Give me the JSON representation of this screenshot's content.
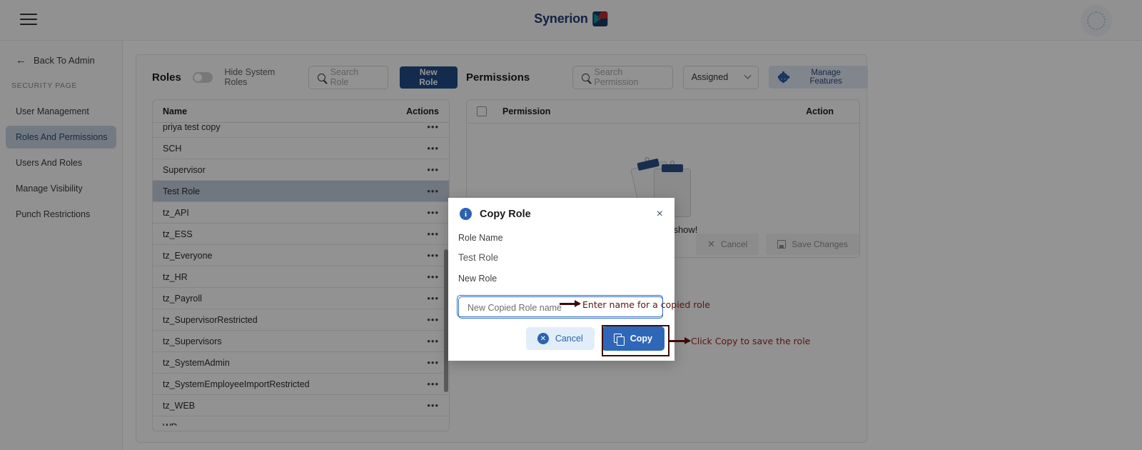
{
  "header": {
    "brand_name": "Synerion",
    "menu_icon": "hamburger-icon",
    "avatar_icon": "user-avatar"
  },
  "sidebar": {
    "back_label": "Back To Admin",
    "section_label": "SECURITY PAGE",
    "items": [
      {
        "label": "User Management",
        "active": false
      },
      {
        "label": "Roles And Permissions",
        "active": true
      },
      {
        "label": "Users And Roles",
        "active": false
      },
      {
        "label": "Manage Visibility",
        "active": false
      },
      {
        "label": "Punch Restrictions",
        "active": false
      }
    ]
  },
  "roles_panel": {
    "title": "Roles",
    "toggle_label": "Hide System Roles",
    "toggle_on": false,
    "search_placeholder": "Search Role",
    "new_role_label": "New Role",
    "columns": [
      "Name",
      "Actions"
    ],
    "action_glyph": "•••",
    "rows": [
      {
        "name": "priya test copy",
        "selected": false
      },
      {
        "name": "SCH",
        "selected": false
      },
      {
        "name": "Supervisor",
        "selected": false
      },
      {
        "name": "Test Role",
        "selected": true
      },
      {
        "name": "tz_API",
        "selected": false
      },
      {
        "name": "tz_ESS",
        "selected": false
      },
      {
        "name": "tz_Everyone",
        "selected": false
      },
      {
        "name": "tz_HR",
        "selected": false
      },
      {
        "name": "tz_Payroll",
        "selected": false
      },
      {
        "name": "tz_SupervisorRestricted",
        "selected": false
      },
      {
        "name": "tz_Supervisors",
        "selected": false
      },
      {
        "name": "tz_SystemAdmin",
        "selected": false
      },
      {
        "name": "tz_SystemEmployeeImportRestricted",
        "selected": false
      },
      {
        "name": "tz_WEB",
        "selected": false
      },
      {
        "name": "WP",
        "selected": false
      }
    ]
  },
  "permissions_panel": {
    "title": "Permissions",
    "search_placeholder": "Search Permission",
    "filter_value": "Assigned",
    "manage_features_label": "Manage Features",
    "columns": [
      "Permission",
      "Action"
    ],
    "empty_text": "Nothing to show!",
    "cancel_label": "Cancel",
    "save_label": "Save Changes"
  },
  "modal": {
    "title": "Copy Role",
    "info_glyph": "i",
    "close_glyph": "×",
    "role_name_label": "Role Name",
    "role_name_value": "Test Role",
    "new_role_label": "New Role",
    "input_placeholder": "New Copied Role name",
    "cancel_label": "Cancel",
    "copy_label": "Copy"
  },
  "annotations": {
    "input_hint": "Enter name for a copied role",
    "copy_hint": "Click Copy to save the role"
  },
  "colors": {
    "brand_navy": "#1f3b73",
    "primary_blue": "#224a86",
    "copy_blue": "#2f67b8",
    "annotation_red": "#5a1410",
    "selected_row": "#c3cddd"
  }
}
